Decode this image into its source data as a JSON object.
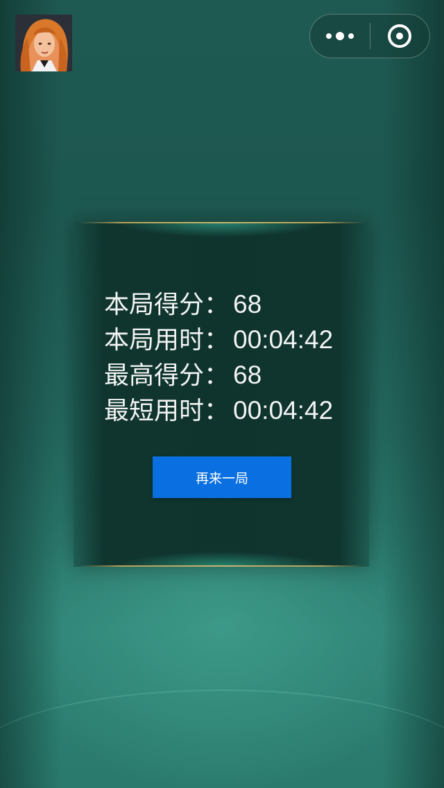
{
  "avatar": {
    "icon": "player-avatar"
  },
  "capsule": {
    "more_icon": "more-dots-icon",
    "close_icon": "target-close-icon"
  },
  "result": {
    "rows": [
      {
        "label": "本局得分：",
        "value": "68"
      },
      {
        "label": "本局用时：",
        "value": "00:04:42"
      },
      {
        "label": "最高得分：",
        "value": "68"
      },
      {
        "label": "最短用时：",
        "value": "00:04:42"
      }
    ],
    "again_label": "再来一局"
  },
  "colors": {
    "background": "#24695f",
    "panel": "#0f332d",
    "accent_line": "#c8b46a",
    "button": "#0a6fe0"
  }
}
